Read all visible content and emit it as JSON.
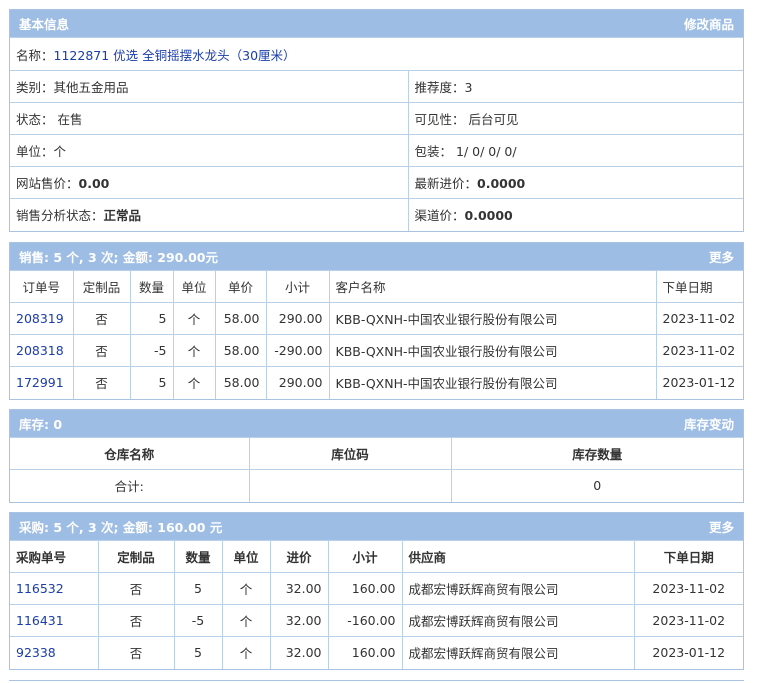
{
  "basic": {
    "title": "基本信息",
    "edit_label": "修改商品",
    "name_label": "名称：",
    "name_value": "1122871 优选 全铜摇摆水龙头（30厘米）",
    "rows": [
      {
        "l_label": "类别：",
        "l_value": "其他五金用品",
        "r_label": "推荐度：",
        "r_value": "3"
      },
      {
        "l_label": "状态：",
        "l_value": "在售",
        "r_label": "可见性：",
        "r_value": "后台可见"
      },
      {
        "l_label": "单位：",
        "l_value": "个",
        "r_label": "包装：",
        "r_value": "1/ 0/ 0/ 0/"
      },
      {
        "l_label": "网站售价：",
        "l_value": "0.00",
        "r_label": "最新进价：",
        "r_value": "0.0000"
      },
      {
        "l_label": "销售分析状态：",
        "l_value": "正常品",
        "r_label": "渠道价：",
        "r_value": "0.0000"
      }
    ]
  },
  "sales": {
    "title": "销售:  5 个, 3 次; 金额: 290.00元",
    "more_label": "更多",
    "headers": [
      "订单号",
      "定制品",
      "数量",
      "单位",
      "单价",
      "小计",
      "客户名称",
      "下单日期"
    ],
    "rows": [
      [
        "208319",
        "否",
        "5",
        "个",
        "58.00",
        "290.00",
        "KBB-QXNH-中国农业银行股份有限公司",
        "2023-11-02"
      ],
      [
        "208318",
        "否",
        "-5",
        "个",
        "58.00",
        "-290.00",
        "KBB-QXNH-中国农业银行股份有限公司",
        "2023-11-02"
      ],
      [
        "172991",
        "否",
        "5",
        "个",
        "58.00",
        "290.00",
        "KBB-QXNH-中国农业银行股份有限公司",
        "2023-01-12"
      ]
    ]
  },
  "stock": {
    "title": "库存:  0",
    "change_label": "库存变动",
    "headers": [
      "仓库名称",
      "库位码",
      "库存数量"
    ],
    "total_label": "合计:",
    "total_location": "",
    "total_qty": "0"
  },
  "purchase": {
    "title": "采购:  5 个, 3 次; 金额: 160.00 元",
    "more_label": "更多",
    "headers": [
      "采购单号",
      "定制品",
      "数量",
      "单位",
      "进价",
      "小计",
      "供应商",
      "下单日期"
    ],
    "rows": [
      [
        "116532",
        "否",
        "5",
        "个",
        "32.00",
        "160.00",
        "成都宏博跃辉商贸有限公司",
        "2023-11-02"
      ],
      [
        "116431",
        "否",
        "-5",
        "个",
        "32.00",
        "-160.00",
        "成都宏博跃辉商贸有限公司",
        "2023-11-02"
      ],
      [
        "92338",
        "否",
        "5",
        "个",
        "32.00",
        "160.00",
        "成都宏博跃辉商贸有限公司",
        "2023-01-12"
      ]
    ]
  }
}
